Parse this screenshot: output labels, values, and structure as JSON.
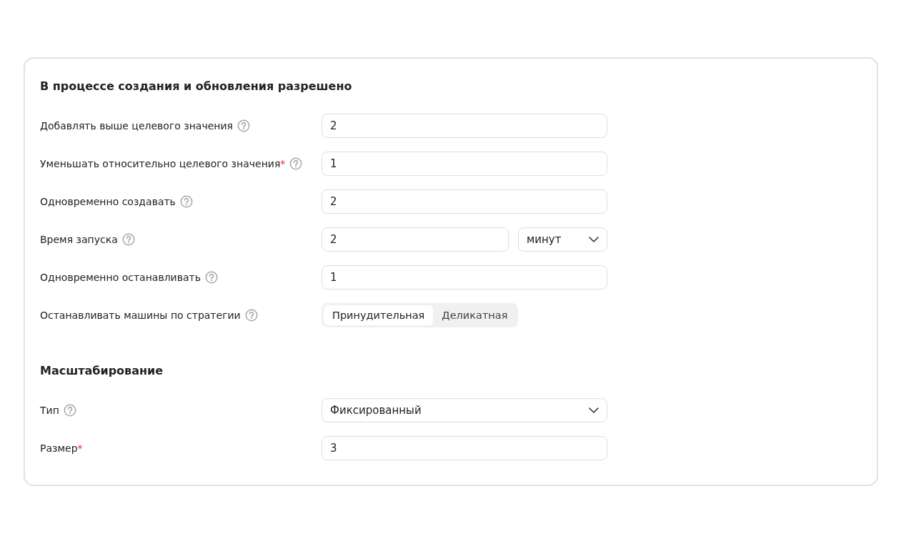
{
  "sections": [
    {
      "title": "В процессе создания и обновления разрешено",
      "fields": [
        {
          "kind": "input",
          "label": "Добавлять выше целевого значения",
          "help": true,
          "value": "2"
        },
        {
          "kind": "input",
          "label": "Уменьшать относительно целевого значения",
          "required_mark": "*",
          "help": true,
          "value": "1"
        },
        {
          "kind": "input",
          "label": "Одновременно создавать",
          "help": true,
          "value": "2"
        },
        {
          "kind": "input-select",
          "label": "Время запуска",
          "help": true,
          "value": "2",
          "unit": "минут"
        },
        {
          "kind": "input",
          "label": "Одновременно останавливать",
          "help": true,
          "value": "1"
        },
        {
          "kind": "segmented",
          "label": "Останавливать машины по стратегии",
          "help": true,
          "options": [
            {
              "label": "Принудительная",
              "selected": true
            },
            {
              "label": "Деликатная",
              "selected": false
            }
          ]
        }
      ]
    },
    {
      "title": "Масштабирование",
      "fields": [
        {
          "kind": "select",
          "label": "Тип",
          "help": true,
          "value": "Фиксированный"
        },
        {
          "kind": "input",
          "label": "Размер",
          "required_mark": "*",
          "help": false,
          "value": "3"
        }
      ]
    }
  ]
}
